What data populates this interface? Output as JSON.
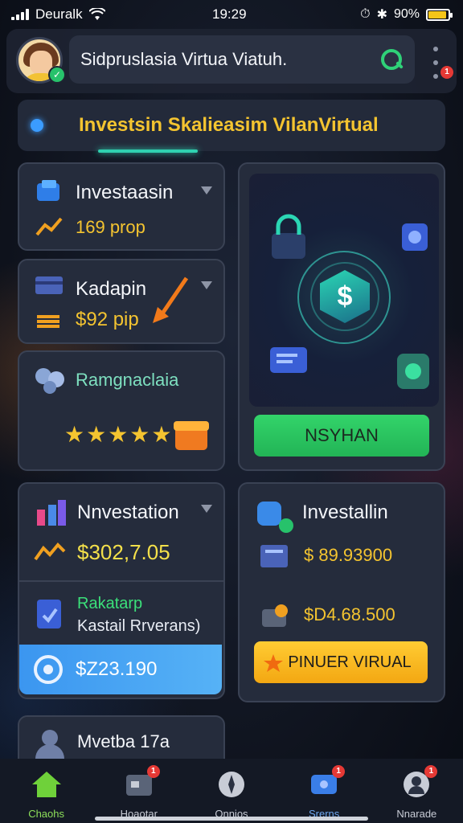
{
  "status_bar": {
    "carrier": "Deuralk",
    "time": "19:29",
    "battery": "90%",
    "battery_level": 0.9
  },
  "header": {
    "search_text": "Sidpruslasia Virtua Viatuh.",
    "notification_count": "1"
  },
  "section": {
    "title": "Investsin Skalieasim VilanVirtual"
  },
  "cards": {
    "investasin": {
      "title": "Investaasin",
      "value": "169 prop"
    },
    "kadapin": {
      "title": "Kadapin",
      "value": "$92 pip"
    },
    "rating": {
      "title": "Ramgnaclaia",
      "stars": "★★★★★"
    },
    "promo": {
      "button_label": "NSYHAN"
    },
    "nvestation": {
      "title": "Nnvestation",
      "value": "$302,7.05",
      "sub_title": "Rakatarp",
      "sub_text": "Kastail Rrverans)",
      "bar_value": "$Z23.190"
    },
    "investallin": {
      "title": "Investallin",
      "value1": "$ 89.93900",
      "value2": "$D4.68.500",
      "button_label": "PINUER VIRUAL"
    },
    "bottom_card": {
      "title": "Mvetba 17a"
    }
  },
  "bottom_nav": [
    {
      "label": "Chaohs",
      "badge": "",
      "active": true
    },
    {
      "label": "Hoaotar",
      "badge": "1",
      "active": false
    },
    {
      "label": "Onnios",
      "badge": "",
      "active": false
    },
    {
      "label": "Srerns",
      "badge": "1",
      "active": false
    },
    {
      "label": "Nnarade",
      "badge": "1",
      "active": false
    }
  ],
  "colors": {
    "accent_yellow": "#f4c430",
    "accent_green": "#2fd178",
    "accent_blue": "#3b9cff",
    "badge_red": "#e53935"
  }
}
